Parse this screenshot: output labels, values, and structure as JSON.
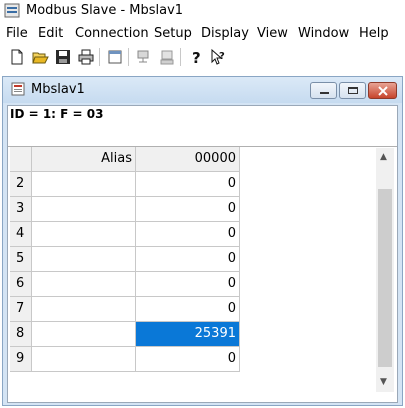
{
  "app": {
    "title": "Modbus Slave - Mbslav1"
  },
  "menu": [
    "File",
    "Edit",
    "Connection",
    "Setup",
    "Display",
    "View",
    "Window",
    "Help"
  ],
  "toolbar": {
    "buttons": [
      "new-icon",
      "open-icon",
      "save-icon",
      "print-icon",
      "window-icon",
      "connect-icon",
      "disconnect-icon",
      "help-icon",
      "context-help-icon"
    ]
  },
  "child": {
    "title": "Mbslav1",
    "info": "ID = 1: F = 03"
  },
  "grid": {
    "header_alias": "Alias",
    "header_col": "00000",
    "rows": [
      {
        "index": "2",
        "alias": "",
        "value": "0"
      },
      {
        "index": "3",
        "alias": "",
        "value": "0"
      },
      {
        "index": "4",
        "alias": "",
        "value": "0"
      },
      {
        "index": "5",
        "alias": "",
        "value": "0"
      },
      {
        "index": "6",
        "alias": "",
        "value": "0"
      },
      {
        "index": "7",
        "alias": "",
        "value": "0"
      },
      {
        "index": "8",
        "alias": "",
        "value": "25391",
        "selected": true
      },
      {
        "index": "9",
        "alias": "",
        "value": "0"
      }
    ]
  },
  "colors": {
    "selection": "#0a78d7"
  }
}
